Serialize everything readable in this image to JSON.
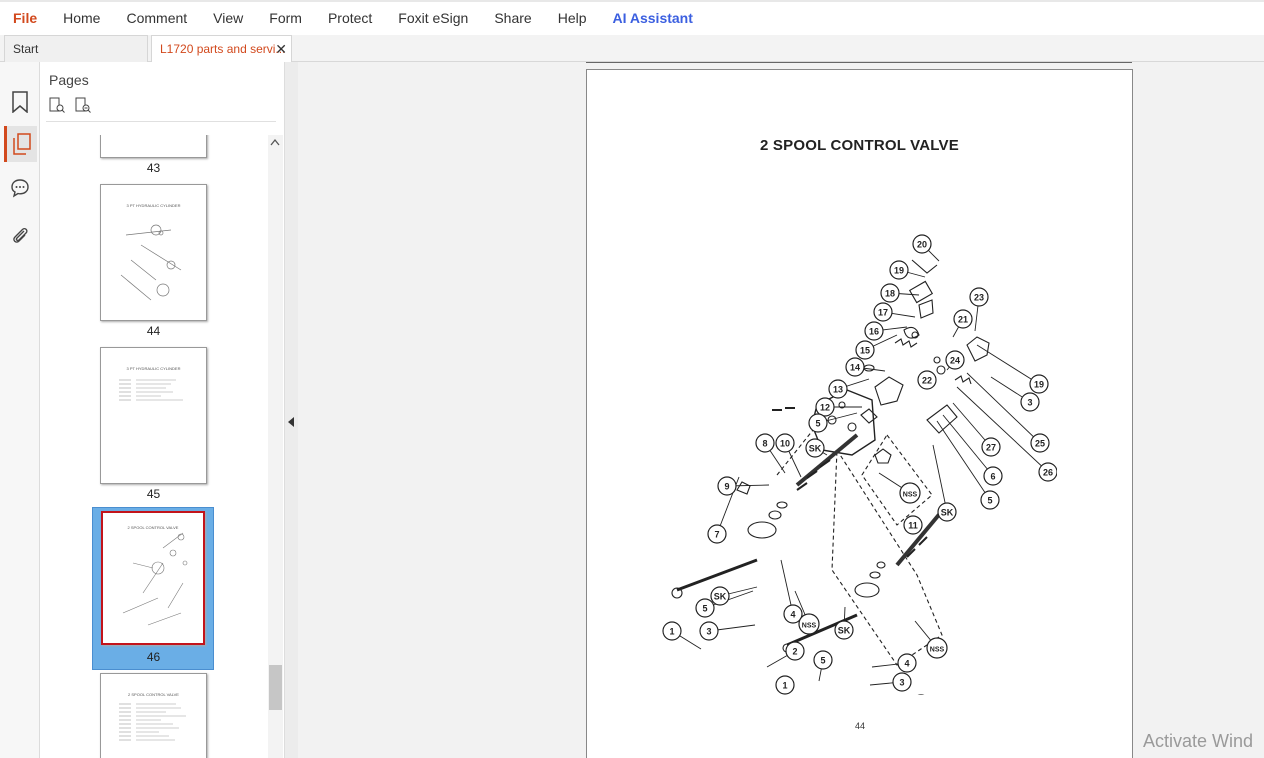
{
  "menu": {
    "items": [
      "File",
      "Home",
      "Comment",
      "View",
      "Form",
      "Protect",
      "Foxit eSign",
      "Share",
      "Help",
      "AI Assistant"
    ]
  },
  "tabs": {
    "start_label": "Start",
    "doc_label": "L1720 parts and servi...",
    "close_symbol": "✕"
  },
  "sidebar": {
    "icons": [
      "bookmark-icon",
      "pages-icon",
      "comment-icon",
      "attachment-icon"
    ]
  },
  "pages_panel": {
    "title": "Pages",
    "thumbnails": [
      {
        "label": "43",
        "title": ""
      },
      {
        "label": "44",
        "title": "3 PT HYDRAULIC CYLINDER"
      },
      {
        "label": "45",
        "title": "3 PT HYDRAULIC CYLINDER"
      },
      {
        "label": "46",
        "title": "2 SPOOL CONTROL VALVE"
      },
      {
        "label": "",
        "title": "2 SPOOL CONTROL VALVE"
      }
    ]
  },
  "document": {
    "title": "2 SPOOL CONTROL VALVE",
    "page_number": "44",
    "callouts": [
      "20",
      "19",
      "18",
      "17",
      "16",
      "15",
      "14",
      "13",
      "12",
      "5",
      "10",
      "8",
      "SK",
      "9",
      "23",
      "21",
      "24",
      "22",
      "3",
      "19",
      "25",
      "26",
      "27",
      "6",
      "5",
      "SK",
      "NSS",
      "11",
      "7",
      "SK",
      "5",
      "4",
      "3",
      "NSS",
      "SK",
      "1",
      "2",
      "5",
      "4",
      "3",
      "1",
      "2",
      "NSS"
    ]
  },
  "system": {
    "watermark": "Activate Wind"
  }
}
